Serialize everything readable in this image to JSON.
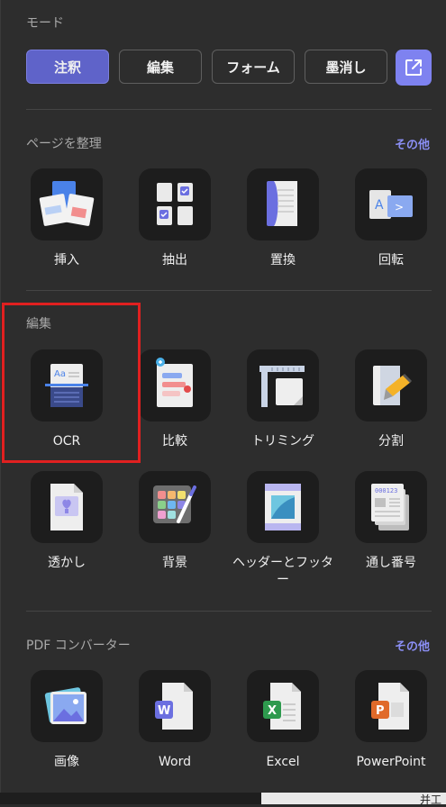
{
  "mode": {
    "title": "モード",
    "buttons": [
      {
        "label": "注釈",
        "active": true
      },
      {
        "label": "編集",
        "active": false
      },
      {
        "label": "フォーム",
        "active": false
      },
      {
        "label": "墨消し",
        "active": false
      }
    ],
    "external_icon": "external-link-icon"
  },
  "organize": {
    "title": "ページを整理",
    "more": "その他",
    "tools": [
      {
        "label": "挿入",
        "icon": "insert-pages-icon"
      },
      {
        "label": "抽出",
        "icon": "extract-pages-icon"
      },
      {
        "label": "置換",
        "icon": "replace-page-icon"
      },
      {
        "label": "回転",
        "icon": "rotate-page-icon"
      }
    ]
  },
  "edit": {
    "title": "編集",
    "tools": [
      {
        "label": "OCR",
        "icon": "ocr-icon"
      },
      {
        "label": "比較",
        "icon": "compare-icon"
      },
      {
        "label": "トリミング",
        "icon": "crop-icon"
      },
      {
        "label": "分割",
        "icon": "split-icon"
      },
      {
        "label": "透かし",
        "icon": "watermark-icon"
      },
      {
        "label": "背景",
        "icon": "background-icon"
      },
      {
        "label": "ヘッダーとフッター",
        "icon": "header-footer-icon"
      },
      {
        "label": "通し番号",
        "icon": "bates-number-icon"
      }
    ]
  },
  "converter": {
    "title": "PDF コンバーター",
    "more": "その他",
    "tools": [
      {
        "label": "画像",
        "icon": "image-convert-icon"
      },
      {
        "label": "Word",
        "icon": "word-convert-icon"
      },
      {
        "label": "Excel",
        "icon": "excel-convert-icon"
      },
      {
        "label": "PowerPoint",
        "icon": "powerpoint-convert-icon"
      }
    ]
  },
  "bottom_fragment": "并工",
  "colors": {
    "accent": "#7e82f0",
    "active_mode": "#5f63c9",
    "highlight": "#e02020",
    "tile_bg": "#1d1d1d"
  }
}
